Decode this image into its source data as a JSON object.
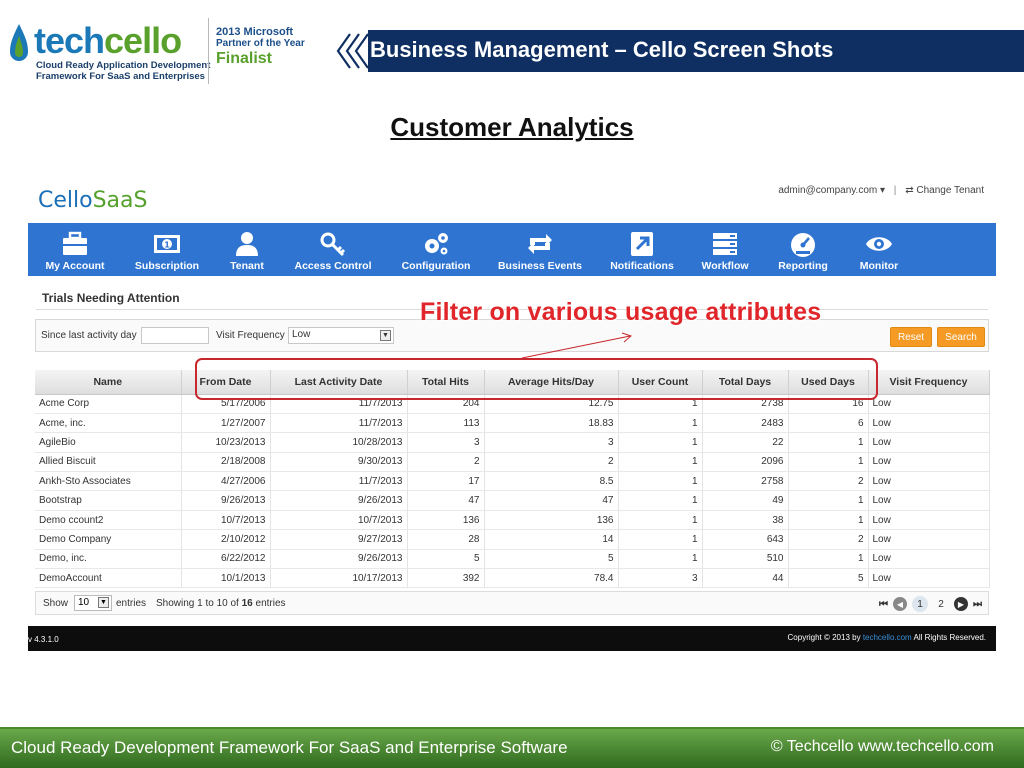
{
  "slide": {
    "logo_word_1": "tech",
    "logo_word_2": "cello",
    "logo_tagline": "Cloud Ready Application Development Framework For SaaS and Enterprises",
    "award_line1": "2013 Microsoft",
    "award_line2": "Partner of the Year",
    "award_line3": "Finalist",
    "title": "Business Management – Cello Screen Shots",
    "heading": "Customer Analytics",
    "annotation": "Filter on various usage attributes",
    "footer_left": "Cloud Ready Development Framework For SaaS and Enterprise Software",
    "footer_right": "© Techcello www.techcello.com",
    "colors": {
      "title_bar": "#0f2f63",
      "nav": "#2e74d0",
      "annotation": "#e0262b",
      "footer_green": "#4a8a2a"
    }
  },
  "app": {
    "brand_1": "Cello",
    "brand_2": "SaaS",
    "user": "admin@company.com ▾",
    "change_tenant": "⇄ Change Tenant",
    "nav": [
      {
        "label": "My Account",
        "icon": "briefcase-icon"
      },
      {
        "label": "Subscription",
        "icon": "money-icon"
      },
      {
        "label": "Tenant",
        "icon": "user-icon"
      },
      {
        "label": "Access Control",
        "icon": "key-icon"
      },
      {
        "label": "Configuration",
        "icon": "gears-icon"
      },
      {
        "label": "Business Events",
        "icon": "retweet-icon"
      },
      {
        "label": "Notifications",
        "icon": "external-link-icon"
      },
      {
        "label": "Workflow",
        "icon": "list-icon"
      },
      {
        "label": "Reporting",
        "icon": "dashboard-icon"
      },
      {
        "label": "Monitor",
        "icon": "eye-icon"
      }
    ],
    "section_title": "Trials Needing Attention",
    "filters": {
      "since_label": "Since last activity day",
      "since_value": "",
      "freq_label": "Visit Frequency",
      "freq_value": "Low",
      "reset": "Reset",
      "search": "Search"
    },
    "table": {
      "columns": [
        "Name",
        "From Date",
        "Last Activity Date",
        "Total Hits",
        "Average Hits/Day",
        "User Count",
        "Total Days",
        "Used Days",
        "Visit Frequency"
      ],
      "rows": [
        [
          "Acme Corp",
          "5/17/2006",
          "11/7/2013",
          "204",
          "12.75",
          "1",
          "2738",
          "16",
          "Low"
        ],
        [
          "Acme, inc.",
          "1/27/2007",
          "11/7/2013",
          "113",
          "18.83",
          "1",
          "2483",
          "6",
          "Low"
        ],
        [
          "AgileBio",
          "10/23/2013",
          "10/28/2013",
          "3",
          "3",
          "1",
          "22",
          "1",
          "Low"
        ],
        [
          "Allied Biscuit",
          "2/18/2008",
          "9/30/2013",
          "2",
          "2",
          "1",
          "2096",
          "1",
          "Low"
        ],
        [
          "Ankh-Sto Associates",
          "4/27/2006",
          "11/7/2013",
          "17",
          "8.5",
          "1",
          "2758",
          "2",
          "Low"
        ],
        [
          "Bootstrap",
          "9/26/2013",
          "9/26/2013",
          "47",
          "47",
          "1",
          "49",
          "1",
          "Low"
        ],
        [
          "Demo ccount2",
          "10/7/2013",
          "10/7/2013",
          "136",
          "136",
          "1",
          "38",
          "1",
          "Low"
        ],
        [
          "Demo Company",
          "2/10/2012",
          "9/27/2013",
          "28",
          "14",
          "1",
          "643",
          "2",
          "Low"
        ],
        [
          "Demo, inc.",
          "6/22/2012",
          "9/26/2013",
          "5",
          "5",
          "1",
          "510",
          "1",
          "Low"
        ],
        [
          "DemoAccount",
          "10/1/2013",
          "10/17/2013",
          "392",
          "78.4",
          "3",
          "44",
          "5",
          "Low"
        ]
      ]
    },
    "footer": {
      "show": "Show",
      "page_size": "10",
      "entries": "entries",
      "showing": "Showing 1 to 10 of ",
      "total": "16",
      "entries2": " entries",
      "page1": "1",
      "page2": "2"
    },
    "version": "v 4.3.1.0",
    "copyright_1": "Copyright © 2013 by ",
    "copyright_link": "techcello.com",
    "copyright_2": " All Rights Reserved."
  }
}
